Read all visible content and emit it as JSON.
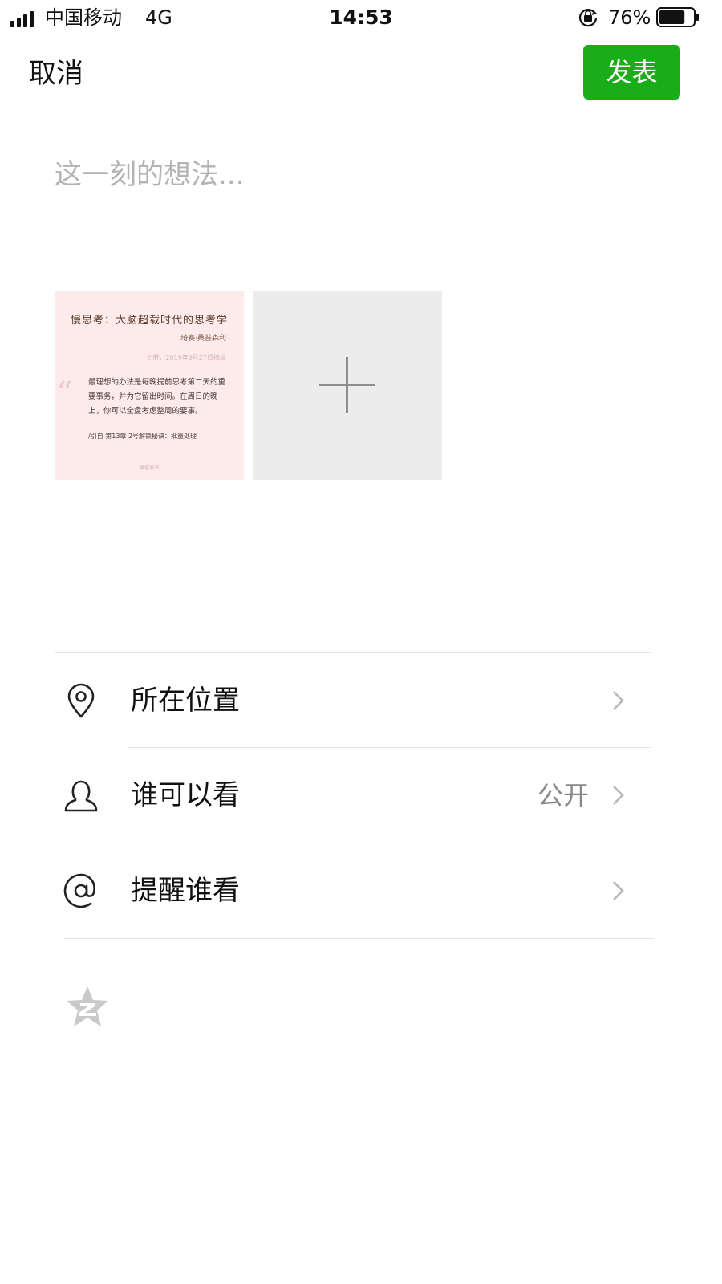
{
  "status_bar": {
    "carrier": "中国移动",
    "network": "4G",
    "time": "14:53",
    "battery_percent": "76%",
    "battery_level": 0.76,
    "icons": [
      "signal-icon",
      "orientation-lock-icon",
      "battery-icon"
    ]
  },
  "nav": {
    "cancel_label": "取消",
    "publish_label": "发表"
  },
  "compose": {
    "placeholder": "这一刻的想法...",
    "value": ""
  },
  "images": {
    "thumbnail": {
      "title": "慢思考：大脑超载时代的思考学",
      "subtitle": "琦赛·桑普森利",
      "date_line": "上册，2019年9月27日摘录",
      "quote_mark": "“",
      "body": "最理想的办法是每晚提前思考第二天的重要事务，并为它留出时间。在周日的晚上，你可以全盘考虑整周的要事。",
      "citation": "/引自 第13章 2号解锁秘诀：批量处理",
      "footer": "微信读书"
    },
    "add_icon": "plus-icon"
  },
  "options": [
    {
      "label": "所在位置",
      "value": "",
      "icon": "location-pin-icon"
    },
    {
      "label": "谁可以看",
      "value": "公开",
      "icon": "person-icon"
    },
    {
      "label": "提醒谁看",
      "value": "",
      "icon": "at-sign-icon"
    }
  ],
  "footer": {
    "icon": "qzone-icon"
  },
  "colors": {
    "accent": "#1aad19",
    "placeholder": "#b3b3b3",
    "secondary_text": "#888888",
    "add_tile_bg": "#ececec",
    "thumbnail_bg": "#fdeaea"
  }
}
